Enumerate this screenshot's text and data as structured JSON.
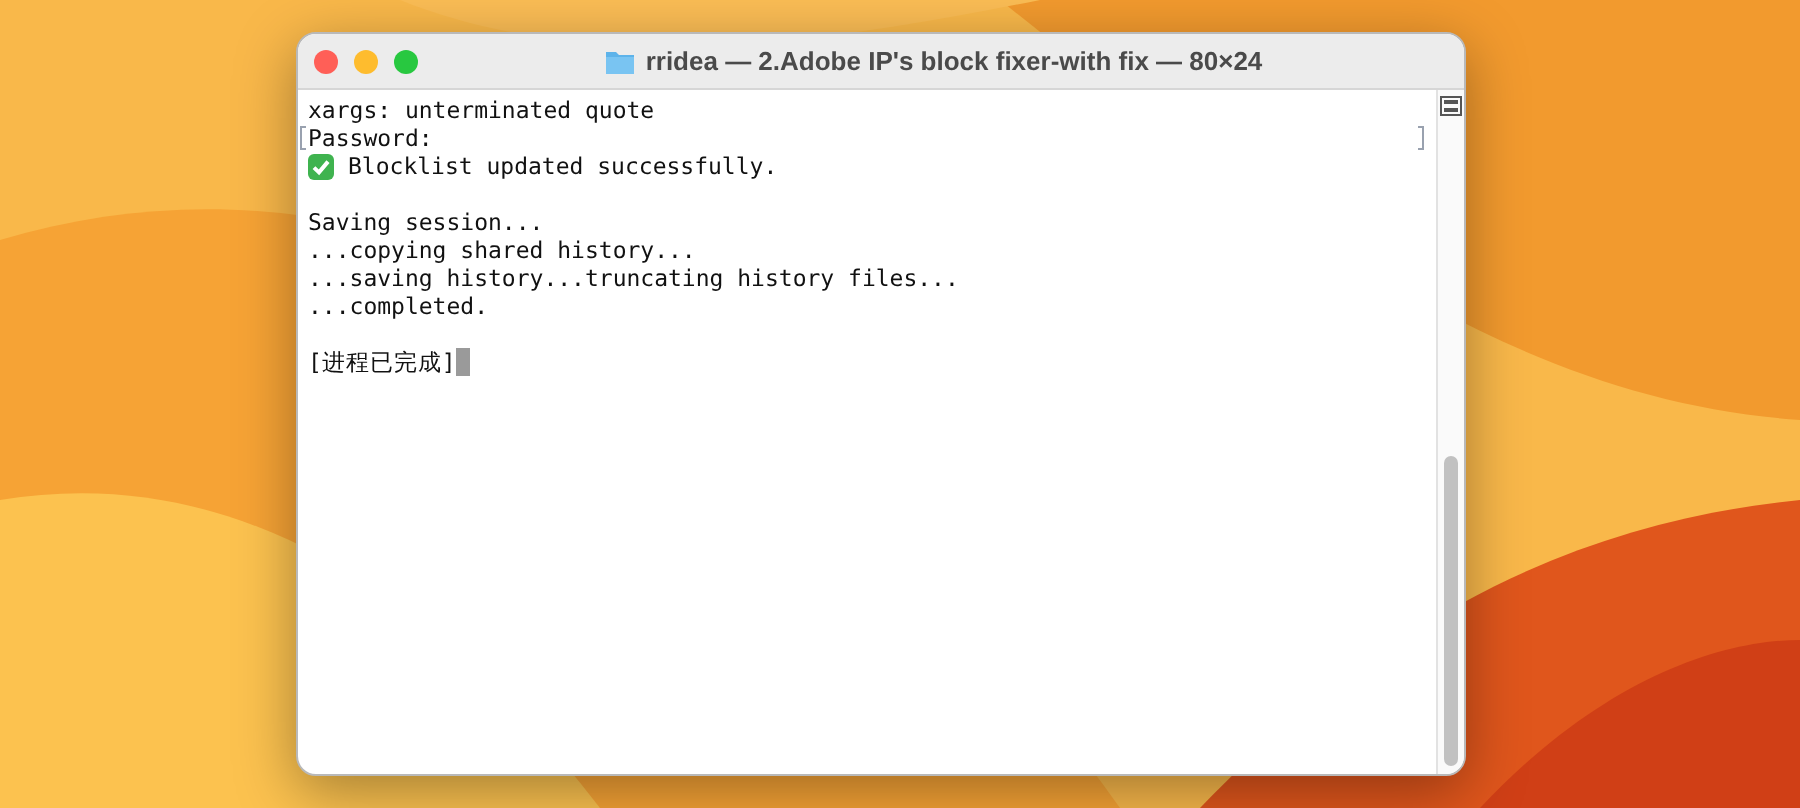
{
  "window": {
    "title": "rridea — 2.Adobe IP's block fixer-with fix — 80×24"
  },
  "lines": [
    {
      "kind": "text",
      "text": "xargs: unterminated quote",
      "marked": false,
      "cursor": false
    },
    {
      "kind": "text",
      "text": "Password:",
      "marked": true,
      "cursor": false
    },
    {
      "kind": "check",
      "text": "Blocklist updated successfully.",
      "marked": false,
      "cursor": false
    },
    {
      "kind": "blank"
    },
    {
      "kind": "text",
      "text": "Saving session...",
      "marked": false,
      "cursor": false
    },
    {
      "kind": "text",
      "text": "...copying shared history...",
      "marked": false,
      "cursor": false
    },
    {
      "kind": "text",
      "text": "...saving history...truncating history files...",
      "marked": false,
      "cursor": false
    },
    {
      "kind": "text",
      "text": "...completed.",
      "marked": false,
      "cursor": false
    },
    {
      "kind": "blank"
    },
    {
      "kind": "text",
      "text": "[进程已完成]",
      "marked": false,
      "cursor": true
    }
  ]
}
